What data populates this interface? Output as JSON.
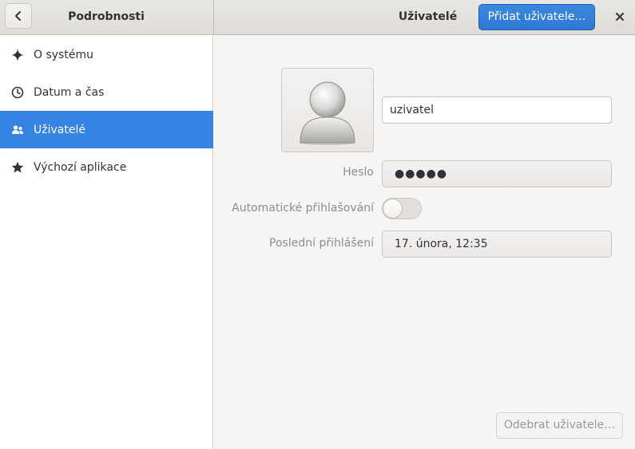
{
  "header": {
    "sidebar_title": "Podrobnosti",
    "main_title": "Uživatelé",
    "add_user_label": "Přidat uživatele…",
    "back_icon": "chevron-left-icon",
    "close_icon": "close-icon"
  },
  "sidebar": {
    "selected_index": 2,
    "items": [
      {
        "label": "O systému",
        "icon": "sparkle-icon"
      },
      {
        "label": "Datum a čas",
        "icon": "clock-icon"
      },
      {
        "label": "Uživatelé",
        "icon": "users-icon"
      },
      {
        "label": "Výchozí aplikace",
        "icon": "star-icon"
      }
    ]
  },
  "user": {
    "avatar_icon": "user-avatar-icon",
    "username": "uzivatel",
    "password_label": "Heslo",
    "password_value": "●●●●●",
    "autologin_label": "Automatické přihlašování",
    "autologin_enabled": false,
    "last_login_label": "Poslední přihlášení",
    "last_login_value": "17. února, 12:35"
  },
  "footer": {
    "remove_user_label": "Odebrat uživatele…"
  },
  "colors": {
    "accent": "#3584e4",
    "sidebar_bg": "#ffffff",
    "window_bg": "#f6f5f4"
  }
}
